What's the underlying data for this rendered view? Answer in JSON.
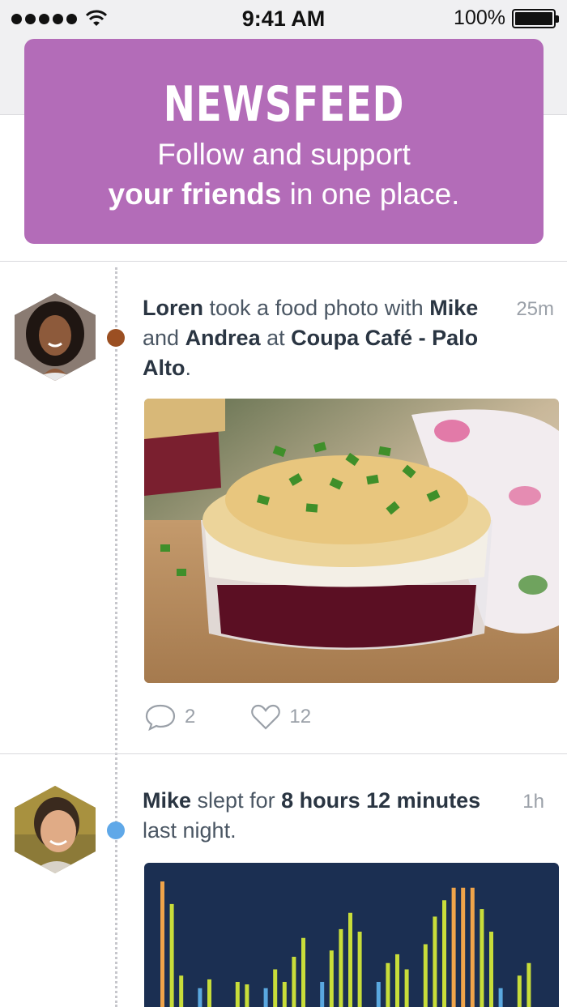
{
  "status_bar": {
    "time": "9:41 AM",
    "battery": "100%"
  },
  "banner": {
    "title": "NEWSFEED",
    "line1": "Follow and support",
    "line2_bold": "your friends",
    "line2_rest": " in one place."
  },
  "feed": {
    "posts": [
      {
        "author": "Loren",
        "t1": " took a food photo with ",
        "friend1": "Mike",
        "t2": " and ",
        "friend2": "Andrea",
        "t3": " at ",
        "place": "Coupa Café - Palo Alto",
        "t4": ".",
        "time": "25m",
        "dot_color": "#9b4f22",
        "comments": "2",
        "likes": "12"
      },
      {
        "author": "Mike",
        "t1": " slept for ",
        "duration": "8 hours 12 minutes",
        "t2": " last night.",
        "time": "1h",
        "dot_color": "#5fa8e8"
      }
    ]
  },
  "sleep_chart": {
    "colors": {
      "deep": "#c8dd3a",
      "rem": "#f0a44a",
      "awake": "#5aa8e0",
      "background": "#1b2f52"
    },
    "bars": [
      {
        "v": 1.0,
        "c": "rem"
      },
      {
        "v": 0.82,
        "c": "deep"
      },
      {
        "v": 0.25,
        "c": "deep"
      },
      {
        "v": 0,
        "c": "deep"
      },
      {
        "v": 0.15,
        "c": "awake"
      },
      {
        "v": 0.22,
        "c": "deep"
      },
      {
        "v": 0,
        "c": "deep"
      },
      {
        "v": 0,
        "c": "deep"
      },
      {
        "v": 0.2,
        "c": "deep"
      },
      {
        "v": 0.18,
        "c": "deep"
      },
      {
        "v": 0,
        "c": "deep"
      },
      {
        "v": 0.15,
        "c": "awake"
      },
      {
        "v": 0.3,
        "c": "deep"
      },
      {
        "v": 0.2,
        "c": "deep"
      },
      {
        "v": 0.4,
        "c": "deep"
      },
      {
        "v": 0.55,
        "c": "deep"
      },
      {
        "v": 0,
        "c": "deep"
      },
      {
        "v": 0.2,
        "c": "awake"
      },
      {
        "v": 0.45,
        "c": "deep"
      },
      {
        "v": 0.62,
        "c": "deep"
      },
      {
        "v": 0.75,
        "c": "deep"
      },
      {
        "v": 0.6,
        "c": "deep"
      },
      {
        "v": 0,
        "c": "deep"
      },
      {
        "v": 0.2,
        "c": "awake"
      },
      {
        "v": 0.35,
        "c": "deep"
      },
      {
        "v": 0.42,
        "c": "deep"
      },
      {
        "v": 0.3,
        "c": "deep"
      },
      {
        "v": 0,
        "c": "deep"
      },
      {
        "v": 0.5,
        "c": "deep"
      },
      {
        "v": 0.72,
        "c": "deep"
      },
      {
        "v": 0.85,
        "c": "deep"
      },
      {
        "v": 0.95,
        "c": "rem"
      },
      {
        "v": 0.95,
        "c": "rem"
      },
      {
        "v": 0.95,
        "c": "rem"
      },
      {
        "v": 0.78,
        "c": "deep"
      },
      {
        "v": 0.6,
        "c": "deep"
      },
      {
        "v": 0.15,
        "c": "awake"
      },
      {
        "v": 0,
        "c": "deep"
      },
      {
        "v": 0.25,
        "c": "deep"
      },
      {
        "v": 0.35,
        "c": "deep"
      }
    ]
  }
}
